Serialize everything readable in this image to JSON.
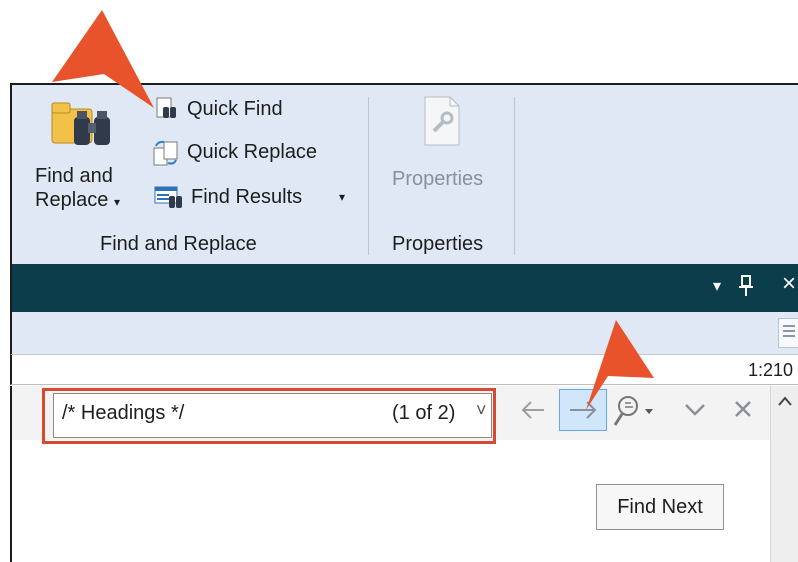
{
  "ribbon": {
    "find_and_replace_button": {
      "line1": "Find and",
      "line2": "Replace",
      "caret": "▾"
    },
    "quick_find": "Quick Find",
    "quick_replace": "Quick Replace",
    "find_results": "Find Results",
    "find_results_caret": "▾",
    "group_find_replace": "Find and Replace",
    "properties_button": "Properties",
    "group_properties": "Properties"
  },
  "pane_header": {
    "dropdown_glyph": "▾",
    "pin_glyph": "ᵖ",
    "close_glyph": "×"
  },
  "status": {
    "position": "1:210"
  },
  "findbar": {
    "search_value": "/* Headings */",
    "match_count": "(1 of 2)",
    "dropdown_glyph": "˅",
    "prev_glyph": "←",
    "next_glyph": "→",
    "options_caret": "▾",
    "expand_glyph": "⌄",
    "close_glyph": "×"
  },
  "tooltip": {
    "text": "Find Next"
  },
  "colors": {
    "accent_arrow": "#e8532b",
    "ribbon_bg": "#dfe8f4",
    "dark_bar": "#0b3d4a",
    "highlight_box": "#d84a2e"
  },
  "icons": [
    "find-and-replace-binoculars-icon",
    "quick-find-icon",
    "quick-replace-icon",
    "find-results-icon",
    "properties-wrench-icon",
    "pin-icon",
    "prev-arrow-icon",
    "next-arrow-icon",
    "search-options-icon",
    "expand-icon",
    "close-icon",
    "scroll-up-icon",
    "callout-arrow-icon"
  ]
}
